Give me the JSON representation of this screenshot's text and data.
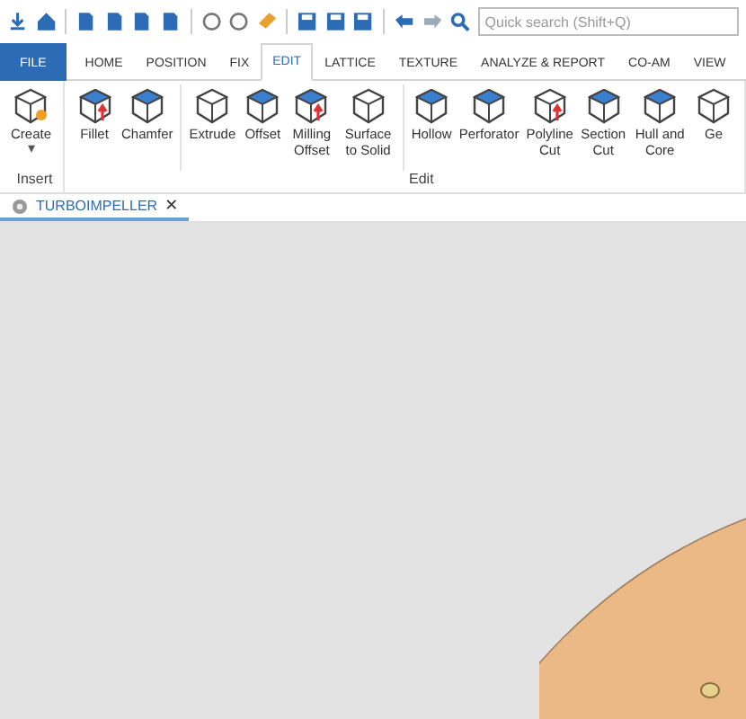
{
  "quick_access": {
    "search": {
      "placeholder": "Quick search (Shift+Q)"
    }
  },
  "tabs": [
    {
      "label": "FILE",
      "kind": "file",
      "selected": false
    },
    {
      "label": "HOME",
      "kind": "tab",
      "selected": false
    },
    {
      "label": "POSITION",
      "kind": "tab",
      "selected": false
    },
    {
      "label": "FIX",
      "kind": "tab",
      "selected": false
    },
    {
      "label": "EDIT",
      "kind": "tab",
      "selected": true
    },
    {
      "label": "LATTICE",
      "kind": "tab",
      "selected": false
    },
    {
      "label": "TEXTURE",
      "kind": "tab",
      "selected": false
    },
    {
      "label": "ANALYZE & REPORT",
      "kind": "tab",
      "selected": false
    },
    {
      "label": "CO-AM",
      "kind": "tab",
      "selected": false
    },
    {
      "label": "VIEW",
      "kind": "tab",
      "selected": false
    }
  ],
  "ribbon": {
    "groups": [
      {
        "label": "Insert",
        "sections": [
          [
            {
              "label": "Create",
              "caret": "▾"
            }
          ]
        ]
      },
      {
        "label": "Edit",
        "sections": [
          [
            {
              "label": "Fillet"
            },
            {
              "label": "Chamfer"
            }
          ],
          [
            {
              "label": "Extrude"
            },
            {
              "label": "Offset"
            },
            {
              "label": "Milling Offset"
            },
            {
              "label": "Surface to Solid"
            }
          ],
          [
            {
              "label": "Hollow"
            },
            {
              "label": "Perforator"
            },
            {
              "label": "Polyline Cut"
            },
            {
              "label": "Section Cut"
            },
            {
              "label": "Hull and Core"
            },
            {
              "label": "Ge"
            }
          ]
        ]
      }
    ]
  },
  "documents": [
    {
      "title": "TURBOIMPELLER",
      "selected": true,
      "close": "✕"
    }
  ],
  "viewport": {
    "kind": "part"
  }
}
